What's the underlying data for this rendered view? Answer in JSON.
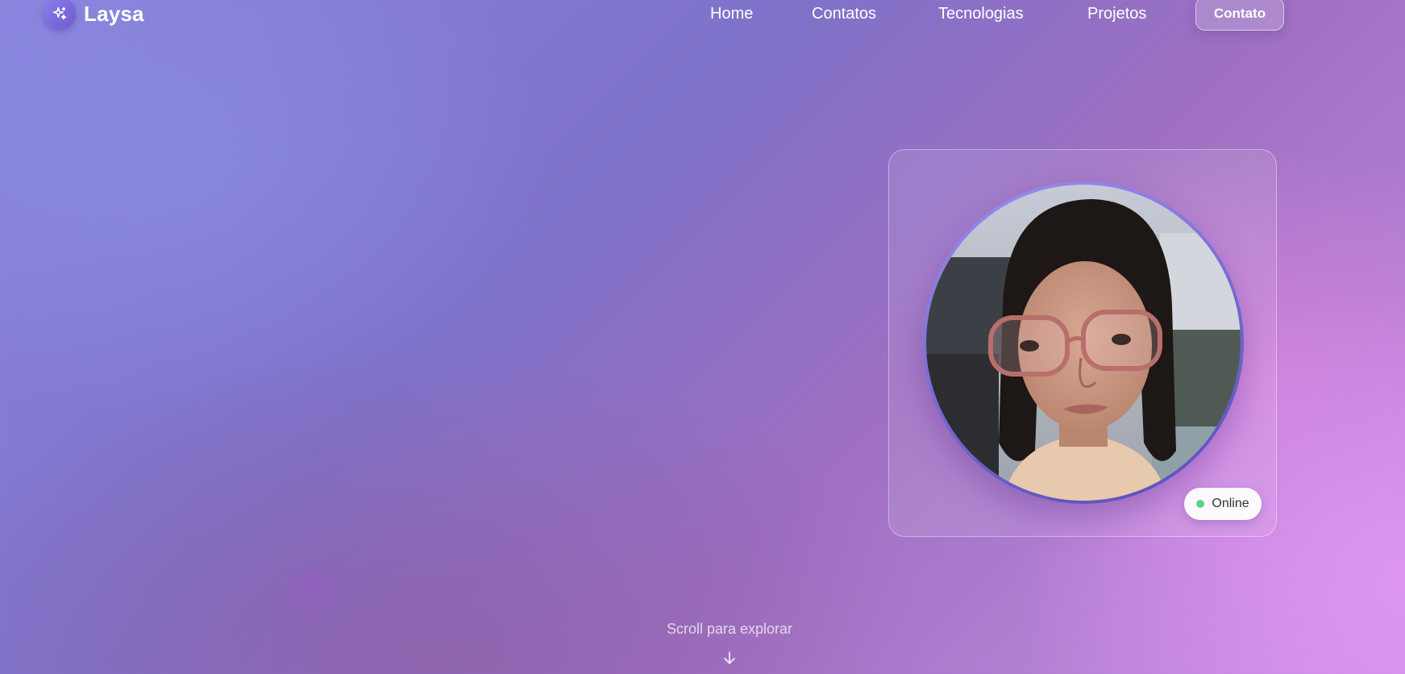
{
  "brand": {
    "name": "Laysa",
    "icon": "sparkles-icon"
  },
  "nav": {
    "links": [
      {
        "label": "Home"
      },
      {
        "label": "Contatos"
      },
      {
        "label": "Tecnologias"
      },
      {
        "label": "Projetos"
      }
    ],
    "cta_label": "Contato"
  },
  "profile": {
    "status_label": "Online",
    "status_color": "#5ed38a"
  },
  "scroll": {
    "label": "Scroll para explorar",
    "icon": "arrow-down-icon"
  },
  "colors": {
    "accent": "#7a6fd6",
    "background_start": "#8a84de",
    "background_end": "#d88ef0"
  }
}
